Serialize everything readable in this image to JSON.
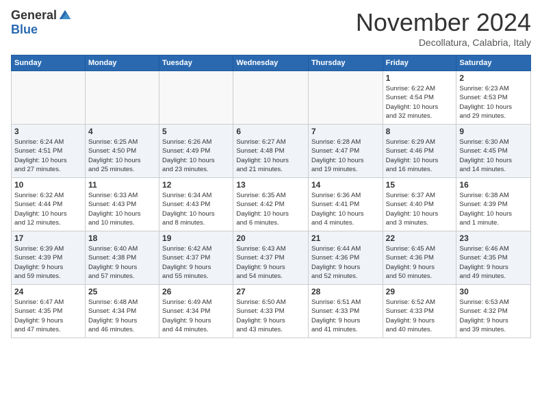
{
  "header": {
    "logo_general": "General",
    "logo_blue": "Blue",
    "month": "November 2024",
    "location": "Decollatura, Calabria, Italy"
  },
  "weekdays": [
    "Sunday",
    "Monday",
    "Tuesday",
    "Wednesday",
    "Thursday",
    "Friday",
    "Saturday"
  ],
  "weeks": [
    [
      {
        "day": "",
        "info": ""
      },
      {
        "day": "",
        "info": ""
      },
      {
        "day": "",
        "info": ""
      },
      {
        "day": "",
        "info": ""
      },
      {
        "day": "",
        "info": ""
      },
      {
        "day": "1",
        "info": "Sunrise: 6:22 AM\nSunset: 4:54 PM\nDaylight: 10 hours\nand 32 minutes."
      },
      {
        "day": "2",
        "info": "Sunrise: 6:23 AM\nSunset: 4:53 PM\nDaylight: 10 hours\nand 29 minutes."
      }
    ],
    [
      {
        "day": "3",
        "info": "Sunrise: 6:24 AM\nSunset: 4:51 PM\nDaylight: 10 hours\nand 27 minutes."
      },
      {
        "day": "4",
        "info": "Sunrise: 6:25 AM\nSunset: 4:50 PM\nDaylight: 10 hours\nand 25 minutes."
      },
      {
        "day": "5",
        "info": "Sunrise: 6:26 AM\nSunset: 4:49 PM\nDaylight: 10 hours\nand 23 minutes."
      },
      {
        "day": "6",
        "info": "Sunrise: 6:27 AM\nSunset: 4:48 PM\nDaylight: 10 hours\nand 21 minutes."
      },
      {
        "day": "7",
        "info": "Sunrise: 6:28 AM\nSunset: 4:47 PM\nDaylight: 10 hours\nand 19 minutes."
      },
      {
        "day": "8",
        "info": "Sunrise: 6:29 AM\nSunset: 4:46 PM\nDaylight: 10 hours\nand 16 minutes."
      },
      {
        "day": "9",
        "info": "Sunrise: 6:30 AM\nSunset: 4:45 PM\nDaylight: 10 hours\nand 14 minutes."
      }
    ],
    [
      {
        "day": "10",
        "info": "Sunrise: 6:32 AM\nSunset: 4:44 PM\nDaylight: 10 hours\nand 12 minutes."
      },
      {
        "day": "11",
        "info": "Sunrise: 6:33 AM\nSunset: 4:43 PM\nDaylight: 10 hours\nand 10 minutes."
      },
      {
        "day": "12",
        "info": "Sunrise: 6:34 AM\nSunset: 4:43 PM\nDaylight: 10 hours\nand 8 minutes."
      },
      {
        "day": "13",
        "info": "Sunrise: 6:35 AM\nSunset: 4:42 PM\nDaylight: 10 hours\nand 6 minutes."
      },
      {
        "day": "14",
        "info": "Sunrise: 6:36 AM\nSunset: 4:41 PM\nDaylight: 10 hours\nand 4 minutes."
      },
      {
        "day": "15",
        "info": "Sunrise: 6:37 AM\nSunset: 4:40 PM\nDaylight: 10 hours\nand 3 minutes."
      },
      {
        "day": "16",
        "info": "Sunrise: 6:38 AM\nSunset: 4:39 PM\nDaylight: 10 hours\nand 1 minute."
      }
    ],
    [
      {
        "day": "17",
        "info": "Sunrise: 6:39 AM\nSunset: 4:39 PM\nDaylight: 9 hours\nand 59 minutes."
      },
      {
        "day": "18",
        "info": "Sunrise: 6:40 AM\nSunset: 4:38 PM\nDaylight: 9 hours\nand 57 minutes."
      },
      {
        "day": "19",
        "info": "Sunrise: 6:42 AM\nSunset: 4:37 PM\nDaylight: 9 hours\nand 55 minutes."
      },
      {
        "day": "20",
        "info": "Sunrise: 6:43 AM\nSunset: 4:37 PM\nDaylight: 9 hours\nand 54 minutes."
      },
      {
        "day": "21",
        "info": "Sunrise: 6:44 AM\nSunset: 4:36 PM\nDaylight: 9 hours\nand 52 minutes."
      },
      {
        "day": "22",
        "info": "Sunrise: 6:45 AM\nSunset: 4:36 PM\nDaylight: 9 hours\nand 50 minutes."
      },
      {
        "day": "23",
        "info": "Sunrise: 6:46 AM\nSunset: 4:35 PM\nDaylight: 9 hours\nand 49 minutes."
      }
    ],
    [
      {
        "day": "24",
        "info": "Sunrise: 6:47 AM\nSunset: 4:35 PM\nDaylight: 9 hours\nand 47 minutes."
      },
      {
        "day": "25",
        "info": "Sunrise: 6:48 AM\nSunset: 4:34 PM\nDaylight: 9 hours\nand 46 minutes."
      },
      {
        "day": "26",
        "info": "Sunrise: 6:49 AM\nSunset: 4:34 PM\nDaylight: 9 hours\nand 44 minutes."
      },
      {
        "day": "27",
        "info": "Sunrise: 6:50 AM\nSunset: 4:33 PM\nDaylight: 9 hours\nand 43 minutes."
      },
      {
        "day": "28",
        "info": "Sunrise: 6:51 AM\nSunset: 4:33 PM\nDaylight: 9 hours\nand 41 minutes."
      },
      {
        "day": "29",
        "info": "Sunrise: 6:52 AM\nSunset: 4:33 PM\nDaylight: 9 hours\nand 40 minutes."
      },
      {
        "day": "30",
        "info": "Sunrise: 6:53 AM\nSunset: 4:32 PM\nDaylight: 9 hours\nand 39 minutes."
      }
    ]
  ]
}
